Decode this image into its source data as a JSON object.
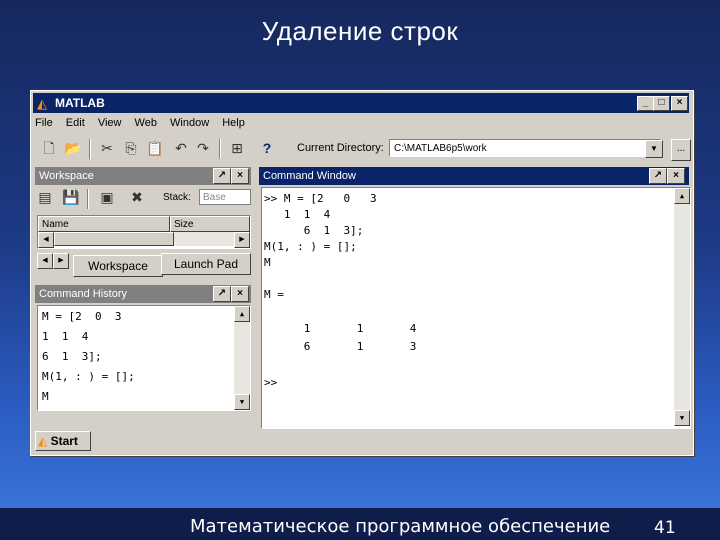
{
  "slide": {
    "title": "Удаление строк",
    "footer": "Математическое программное обеспечение",
    "page_number": "41"
  },
  "window": {
    "title": "MATLAB",
    "menu": [
      "File",
      "Edit",
      "View",
      "Web",
      "Window",
      "Help"
    ],
    "current_directory_label": "Current Directory:",
    "current_directory_value": "C:\\MATLAB6p5\\work",
    "browse_label": "..."
  },
  "workspace": {
    "title": "Workspace",
    "stack_label": "Stack:",
    "stack_value": "Base",
    "columns": [
      "Name",
      "Size"
    ],
    "tabs": [
      "Workspace",
      "Launch Pad"
    ]
  },
  "history": {
    "title": "Command History",
    "lines": [
      "M = [2  0  3",
      "1  1  4",
      "6  1  3];",
      "M(1, : ) = [];",
      "M"
    ]
  },
  "command_window": {
    "title": "Command Window",
    "lines": [
      ">> M = [2   0   3",
      "   1  1  4",
      "      6  1  3];",
      "M(1, : ) = [];",
      "M",
      "",
      "M =",
      "",
      "      1       1       4",
      "      6       1       3",
      "",
      ">>"
    ]
  },
  "start": {
    "label": "Start"
  },
  "colors": {
    "active_title": "#0a246a",
    "inactive_title": "#808080",
    "window_face": "#d4d0c8"
  }
}
